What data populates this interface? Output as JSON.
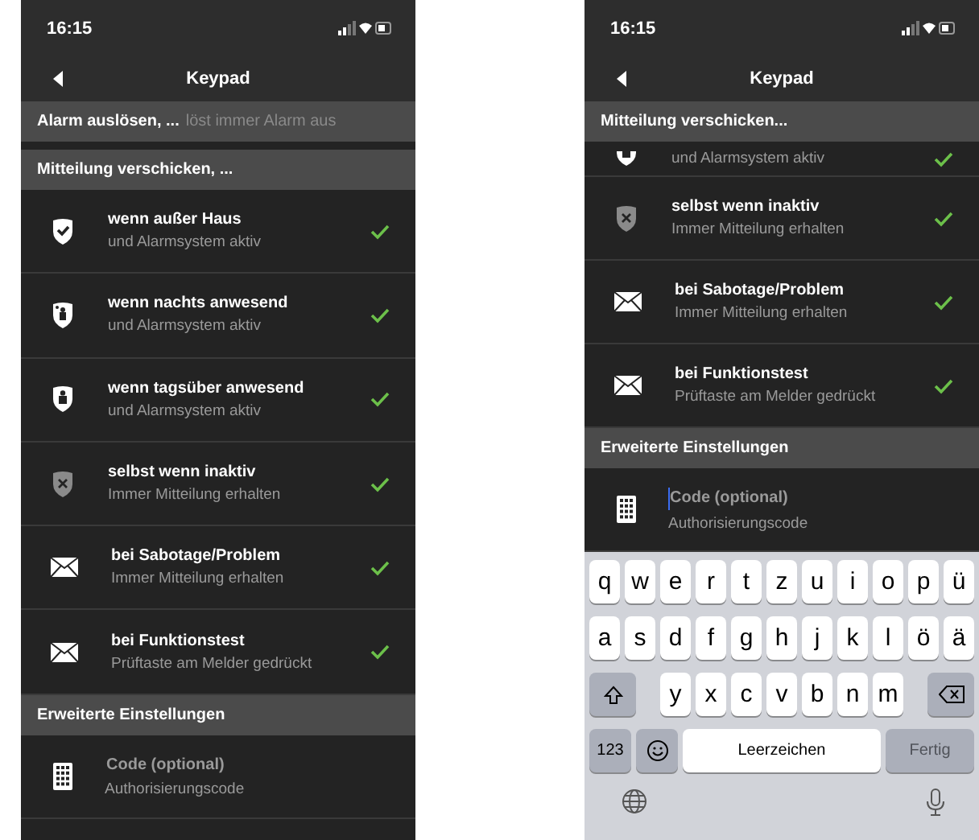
{
  "phones": [
    {
      "status_bar": {
        "time": "16:15"
      },
      "nav": {
        "title": "Keypad"
      },
      "sections": [
        {
          "header": "Alarm auslösen, ...",
          "behind_text": "löst immer Alarm aus"
        },
        {
          "header": "Mitteilung verschicken, ...",
          "rows": [
            {
              "kind": "check-shield",
              "title": "wenn außer Haus",
              "subtitle": "und Alarmsystem aktiv",
              "checked": true
            },
            {
              "kind": "night-shield",
              "title": "wenn nachts anwesend",
              "subtitle": "und Alarmsystem aktiv",
              "checked": true
            },
            {
              "kind": "person-shield",
              "title": "wenn tagsüber anwesend",
              "subtitle": "und Alarmsystem aktiv",
              "checked": true
            },
            {
              "kind": "cross-shield",
              "title": "selbst wenn inaktiv",
              "subtitle": "Immer Mitteilung erhalten",
              "checked": true
            },
            {
              "kind": "envelope",
              "title": "bei Sabotage/Problem",
              "subtitle": "Immer Mitteilung erhalten",
              "checked": true
            },
            {
              "kind": "envelope",
              "title": "bei Funktionstest",
              "subtitle": "Prüftaste am Melder gedrückt",
              "checked": true
            }
          ]
        },
        {
          "header": "Erweiterte Einstellungen",
          "rows": [
            {
              "kind": "code",
              "placeholder": "Code (optional)",
              "subtitle": "Authorisierungscode",
              "focused": false
            }
          ]
        }
      ]
    },
    {
      "status_bar": {
        "time": "16:15"
      },
      "nav": {
        "title": "Keypad"
      },
      "sections": [
        {
          "header": "Mitteilung verschicken...",
          "rows": [
            {
              "kind": "person-shield",
              "subtitle": "und Alarmsystem aktiv",
              "checked": true
            },
            {
              "kind": "cross-shield",
              "title": "selbst wenn inaktiv",
              "subtitle": "Immer Mitteilung erhalten",
              "checked": true
            },
            {
              "kind": "envelope",
              "title": "bei Sabotage/Problem",
              "subtitle": "Immer Mitteilung erhalten",
              "checked": true
            },
            {
              "kind": "envelope",
              "title": "bei Funktionstest",
              "subtitle": "Prüftaste am Melder gedrückt",
              "checked": true
            }
          ]
        },
        {
          "header": "Erweiterte Einstellungen",
          "rows": [
            {
              "kind": "code",
              "placeholder": "Code (optional)",
              "subtitle": "Authorisierungscode",
              "focused": true
            }
          ]
        }
      ],
      "keyboard": {
        "top_row": [
          "q",
          "w",
          "e",
          "r",
          "t",
          "z",
          "u",
          "i",
          "o",
          "p",
          "ü"
        ],
        "middle_row": [
          "a",
          "s",
          "d",
          "f",
          "g",
          "h",
          "j",
          "k",
          "l",
          "ö",
          "ä"
        ],
        "bottom_row": [
          "y",
          "x",
          "c",
          "v",
          "b",
          "n",
          "m"
        ],
        "numbers_key": "123",
        "space_key": "Leerzeichen",
        "done_key": "Fertig"
      }
    }
  ]
}
